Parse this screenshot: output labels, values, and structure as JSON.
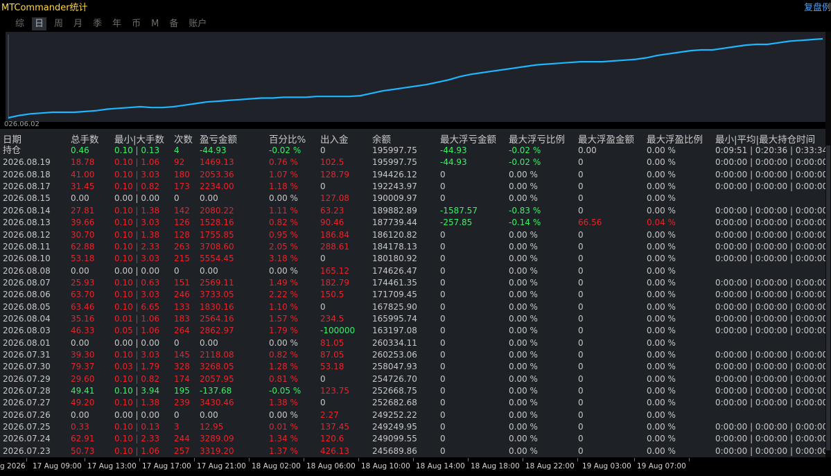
{
  "app": {
    "title": "MTCommander统计",
    "right_title": "复盘例"
  },
  "tabs": [
    "综",
    "日",
    "周",
    "月",
    "季",
    "年",
    "币",
    "M",
    "备",
    "账户"
  ],
  "active_tab": 1,
  "chart": {
    "date_label": "026.06.02",
    "line_color": "#1fb6ff",
    "values": [
      0.0,
      0.02,
      0.04,
      0.06,
      0.08,
      0.1,
      0.12,
      0.14,
      0.16,
      0.18,
      0.2,
      0.22,
      0.24,
      0.26,
      0.28,
      0.3,
      0.32,
      0.34,
      0.36,
      0.38,
      0.4,
      0.42,
      0.44,
      0.46,
      0.48,
      0.5,
      0.52,
      0.54,
      0.56,
      0.58,
      0.6,
      0.62,
      0.64,
      0.66,
      0.68,
      0.7,
      0.72,
      0.74,
      0.76,
      0.78,
      0.8,
      0.82,
      0.84,
      0.86,
      0.88,
      0.9,
      0.92,
      0.94,
      0.96,
      0.98,
      1.0
    ]
  },
  "columns": [
    "日期",
    "总手数",
    "最小|大手数",
    "次数",
    "盈亏金额",
    "百分比%",
    "出入金",
    "余额",
    "最大浮亏金额",
    "最大浮亏比例",
    "最大浮盈金额",
    "最大浮盈比例",
    "最小|平均|最大持仓时间"
  ],
  "rows": [
    [
      "持仓",
      "0.46",
      "0.10 | 0.13",
      "4",
      "-44.93",
      "-0.02 %",
      "0",
      "195997.75",
      "-44.93",
      "-0.02 %",
      "0.00",
      "0.00 %",
      "0:09:51 | 0:20:36 | 0:33:34"
    ],
    [
      "2026.08.19",
      "18.78",
      "0.10 | 1.06",
      "92",
      "1469.13",
      "0.76 %",
      "102.5",
      "195997.75",
      "-44.93",
      "-0.02 %",
      "0",
      "0.00 %",
      "0:00:00 | 0:00:00 | 0:00:00"
    ],
    [
      "2026.08.18",
      "41.00",
      "0.10 | 3.03",
      "180",
      "2053.36",
      "1.07 %",
      "128.79",
      "194426.12",
      "0",
      "0.00 %",
      "0",
      "0.00 %",
      "0:00:00 | 0:00:00 | 0:00:00"
    ],
    [
      "2026.08.17",
      "31.45",
      "0.10 | 0.82",
      "173",
      "2234.00",
      "1.18 %",
      "0",
      "192243.97",
      "0",
      "0.00 %",
      "0",
      "0.00 %",
      "0:00:00 | 0:00:00 | 0:00:00"
    ],
    [
      "2026.08.15",
      "0.00",
      "0.00 | 0.00",
      "0",
      "0.00",
      "0.00 %",
      "127.08",
      "190009.97",
      "0",
      "0.00 %",
      "0",
      "0.00 %",
      ""
    ],
    [
      "2026.08.14",
      "27.81",
      "0.10 | 1.38",
      "142",
      "2080.22",
      "1.11 %",
      "63.23",
      "189882.89",
      "-1587.57",
      "-0.83 %",
      "0",
      "0.00 %",
      "0:00:00 | 0:00:00 | 0:00:00"
    ],
    [
      "2026.08.13",
      "39.66",
      "0.10 | 3.03",
      "126",
      "1528.16",
      "0.82 %",
      "90.46",
      "187739.44",
      "-257.85",
      "-0.14 %",
      "66.56",
      "0.04 %",
      "0:00:00 | 0:00:00 | 0:00:00"
    ],
    [
      "2026.08.12",
      "30.70",
      "0.10 | 1.38",
      "128",
      "1755.85",
      "0.95 %",
      "186.84",
      "186120.82",
      "0",
      "0.00 %",
      "0",
      "0.00 %",
      "0:00:00 | 0:00:00 | 0:00:00"
    ],
    [
      "2026.08.11",
      "62.88",
      "0.10 | 2.33",
      "263",
      "3708.60",
      "2.05 %",
      "288.61",
      "184178.13",
      "0",
      "0.00 %",
      "0",
      "0.00 %",
      "0:00:00 | 0:00:00 | 0:00:00"
    ],
    [
      "2026.08.10",
      "53.18",
      "0.10 | 3.03",
      "215",
      "5554.45",
      "3.18 %",
      "0",
      "180180.92",
      "0",
      "0.00 %",
      "0",
      "0.00 %",
      "0:00:00 | 0:00:00 | 0:00:00"
    ],
    [
      "2026.08.08",
      "0.00",
      "0.00 | 0.00",
      "0",
      "0.00",
      "0.00 %",
      "165.12",
      "174626.47",
      "0",
      "0.00 %",
      "0",
      "0.00 %",
      ""
    ],
    [
      "2026.08.07",
      "25.93",
      "0.10 | 0.63",
      "151",
      "2569.11",
      "1.49 %",
      "182.79",
      "174461.35",
      "0",
      "0.00 %",
      "0",
      "0.00 %",
      "0:00:00 | 0:00:00 | 0:00:00"
    ],
    [
      "2026.08.06",
      "63.70",
      "0.10 | 3.03",
      "246",
      "3733.05",
      "2.22 %",
      "150.5",
      "171709.45",
      "0",
      "0.00 %",
      "0",
      "0.00 %",
      "0:00:00 | 0:00:00 | 0:00:00"
    ],
    [
      "2026.08.05",
      "63.46",
      "0.10 | 6.65",
      "133",
      "1830.16",
      "1.10 %",
      "0",
      "167825.90",
      "0",
      "0.00 %",
      "0",
      "0.00 %",
      "0:00:00 | 0:00:00 | 0:00:00"
    ],
    [
      "2026.08.04",
      "35.16",
      "0.01 | 1.06",
      "183",
      "2564.16",
      "1.57 %",
      "234.5",
      "165995.74",
      "0",
      "0.00 %",
      "0",
      "0.00 %",
      "0:00:00 | 0:00:00 | 0:00:00"
    ],
    [
      "2026.08.03",
      "46.33",
      "0.05 | 1.06",
      "264",
      "2862.97",
      "1.79 %",
      "-100000",
      "163197.08",
      "0",
      "0.00 %",
      "0",
      "0.00 %",
      "0:00:00 | 0:00:00 | 0:00:00"
    ],
    [
      "2026.08.01",
      "0.00",
      "0.00 | 0.00",
      "0",
      "0.00",
      "0.00 %",
      "81.05",
      "260334.11",
      "0",
      "0.00 %",
      "0",
      "0.00 %",
      ""
    ],
    [
      "2026.07.31",
      "39.30",
      "0.10 | 3.03",
      "145",
      "2118.08",
      "0.82 %",
      "87.05",
      "260253.06",
      "0",
      "0.00 %",
      "0",
      "0.00 %",
      "0:00:00 | 0:00:00 | 0:00:00"
    ],
    [
      "2026.07.30",
      "79.37",
      "0.03 | 1.79",
      "328",
      "3268.05",
      "1.28 %",
      "53.18",
      "258047.93",
      "0",
      "0.00 %",
      "0",
      "0.00 %",
      "0:00:00 | 0:00:00 | 0:00:00"
    ],
    [
      "2026.07.29",
      "29.60",
      "0.10 | 0.82",
      "174",
      "2057.95",
      "0.81 %",
      "0",
      "254726.70",
      "0",
      "0.00 %",
      "0",
      "0.00 %",
      "0:00:00 | 0:00:00 | 0:00:00"
    ],
    [
      "2026.07.28",
      "49.41",
      "0.10 | 3.94",
      "195",
      "-137.68",
      "-0.05 %",
      "123.75",
      "252668.75",
      "0",
      "0.00 %",
      "0",
      "0.00 %",
      "0:00:00 | 0:00:00 | 0:00:00"
    ],
    [
      "2026.07.27",
      "49.20",
      "0.10 | 1.38",
      "239",
      "3430.46",
      "1.38 %",
      "0",
      "252682.68",
      "0",
      "0.00 %",
      "0",
      "0.00 %",
      "0:00:00 | 0:00:00 | 0:00:00"
    ],
    [
      "2026.07.26",
      "0.00",
      "0.00 | 0.00",
      "0",
      "0.00",
      "0.00 %",
      "2.27",
      "249252.22",
      "0",
      "0.00 %",
      "0",
      "0.00 %",
      ""
    ],
    [
      "2026.07.25",
      "0.33",
      "0.10 | 0.13",
      "3",
      "12.95",
      "0.01 %",
      "137.45",
      "249249.95",
      "0",
      "0.00 %",
      "0",
      "0.00 %",
      "0:00:00 | 0:00:00 | 0:00:00"
    ],
    [
      "2026.07.24",
      "62.91",
      "0.10 | 2.33",
      "244",
      "3289.09",
      "1.34 %",
      "120.6",
      "249099.55",
      "0",
      "0.00 %",
      "0",
      "0.00 %",
      "0:00:00 | 0:00:00 | 0:00:00"
    ],
    [
      "2026.07.23",
      "50.73",
      "0.10 | 1.06",
      "257",
      "3319.20",
      "1.37 %",
      "426.13",
      "245689.86",
      "0",
      "0.00 %",
      "0",
      "0.00 %",
      "0:00:00 | 0:00:00 | 0:00:00"
    ]
  ],
  "row_colors": [
    [
      "def",
      "green",
      "green",
      "green",
      "green",
      "green",
      "def",
      "def",
      "green",
      "green",
      "def",
      "def",
      "def"
    ],
    [
      "def",
      "red",
      "red",
      "red",
      "red",
      "red",
      "red",
      "def",
      "green",
      "green",
      "def",
      "def",
      "def"
    ],
    [
      "def",
      "red",
      "red",
      "red",
      "red",
      "red",
      "red",
      "def",
      "def",
      "def",
      "def",
      "def",
      "def"
    ],
    [
      "def",
      "red",
      "red",
      "red",
      "red",
      "red",
      "def",
      "def",
      "def",
      "def",
      "def",
      "def",
      "def"
    ],
    [
      "def",
      "def",
      "def",
      "def",
      "def",
      "def",
      "red",
      "def",
      "def",
      "def",
      "def",
      "def",
      "def"
    ],
    [
      "def",
      "red",
      "red",
      "red",
      "red",
      "red",
      "red",
      "def",
      "green",
      "green",
      "def",
      "def",
      "def"
    ],
    [
      "def",
      "red",
      "red",
      "red",
      "red",
      "red",
      "red",
      "def",
      "green",
      "green",
      "red",
      "red",
      "def"
    ],
    [
      "def",
      "red",
      "red",
      "red",
      "red",
      "red",
      "red",
      "def",
      "def",
      "def",
      "def",
      "def",
      "def"
    ],
    [
      "def",
      "red",
      "red",
      "red",
      "red",
      "red",
      "red",
      "def",
      "def",
      "def",
      "def",
      "def",
      "def"
    ],
    [
      "def",
      "red",
      "red",
      "red",
      "red",
      "red",
      "def",
      "def",
      "def",
      "def",
      "def",
      "def",
      "def"
    ],
    [
      "def",
      "def",
      "def",
      "def",
      "def",
      "def",
      "red",
      "def",
      "def",
      "def",
      "def",
      "def",
      "def"
    ],
    [
      "def",
      "red",
      "red",
      "red",
      "red",
      "red",
      "red",
      "def",
      "def",
      "def",
      "def",
      "def",
      "def"
    ],
    [
      "def",
      "red",
      "red",
      "red",
      "red",
      "red",
      "red",
      "def",
      "def",
      "def",
      "def",
      "def",
      "def"
    ],
    [
      "def",
      "red",
      "red",
      "red",
      "red",
      "red",
      "def",
      "def",
      "def",
      "def",
      "def",
      "def",
      "def"
    ],
    [
      "def",
      "red",
      "red",
      "red",
      "red",
      "red",
      "red",
      "def",
      "def",
      "def",
      "def",
      "def",
      "def"
    ],
    [
      "def",
      "red",
      "red",
      "red",
      "red",
      "red",
      "green",
      "def",
      "def",
      "def",
      "def",
      "def",
      "def"
    ],
    [
      "def",
      "def",
      "def",
      "def",
      "def",
      "def",
      "red",
      "def",
      "def",
      "def",
      "def",
      "def",
      "def"
    ],
    [
      "def",
      "red",
      "red",
      "red",
      "red",
      "red",
      "red",
      "def",
      "def",
      "def",
      "def",
      "def",
      "def"
    ],
    [
      "def",
      "red",
      "red",
      "red",
      "red",
      "red",
      "red",
      "def",
      "def",
      "def",
      "def",
      "def",
      "def"
    ],
    [
      "def",
      "red",
      "red",
      "red",
      "red",
      "red",
      "def",
      "def",
      "def",
      "def",
      "def",
      "def",
      "def"
    ],
    [
      "def",
      "green",
      "green",
      "green",
      "green",
      "green",
      "red",
      "def",
      "def",
      "def",
      "def",
      "def",
      "def"
    ],
    [
      "def",
      "red",
      "red",
      "red",
      "red",
      "red",
      "def",
      "def",
      "def",
      "def",
      "def",
      "def",
      "def"
    ],
    [
      "def",
      "def",
      "def",
      "def",
      "def",
      "def",
      "red",
      "def",
      "def",
      "def",
      "def",
      "def",
      "def"
    ],
    [
      "def",
      "red",
      "red",
      "red",
      "red",
      "red",
      "red",
      "def",
      "def",
      "def",
      "def",
      "def",
      "def"
    ],
    [
      "def",
      "red",
      "red",
      "red",
      "red",
      "red",
      "red",
      "def",
      "def",
      "def",
      "def",
      "def",
      "def"
    ],
    [
      "def",
      "red",
      "red",
      "red",
      "red",
      "red",
      "red",
      "def",
      "def",
      "def",
      "def",
      "def",
      "def"
    ]
  ],
  "time_axis": [
    "g 2026",
    "17 Aug 09:00",
    "17 Aug 13:00",
    "17 Aug 17:00",
    "17 Aug 21:00",
    "18 Aug 02:00",
    "18 Aug 06:00",
    "18 Aug 10:00",
    "18 Aug 14:00",
    "18 Aug 18:00",
    "18 Aug 22:00",
    "19 Aug 03:00",
    "19 Aug 07:00"
  ]
}
